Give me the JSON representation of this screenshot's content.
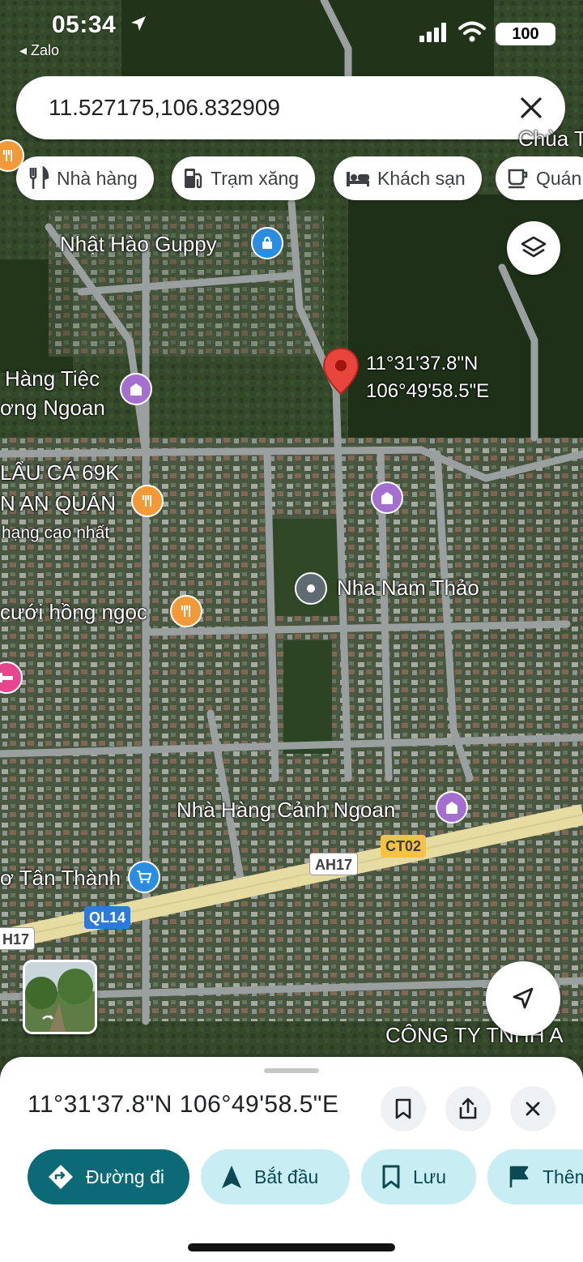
{
  "status_bar": {
    "time": "05:34",
    "back_app": "◂ Zalo",
    "battery": "100"
  },
  "search": {
    "value": "11.527175,106.832909"
  },
  "chips": [
    {
      "label": "Nhà hàng",
      "icon": "fork-knife-icon"
    },
    {
      "label": "Trạm xăng",
      "icon": "gas-station-icon"
    },
    {
      "label": "Khách sạn",
      "icon": "bed-icon"
    },
    {
      "label": "Quán",
      "icon": "coffee-cup-icon"
    }
  ],
  "map": {
    "pin_coords": {
      "line1": "11°31'37.8\"N",
      "line2": "106°49'58.5\"E"
    },
    "labels": {
      "guppy": "Nhật Hào Guppy",
      "hang_tiec_1": "Hàng Tiệc",
      "hang_tiec_2": "ơng Ngoan",
      "lau_ca_1": "LẨU CÁ 69K",
      "lau_ca_2": "N AN QUÁN",
      "lau_ca_3": "hạng cao nhất",
      "nam_thao": "Nha Nam Thảo",
      "hong_ngoc": "cưới hồng ngọc",
      "canh_ngoan": "Nhà Hàng Cảnh Ngoan",
      "tan_thanh": "ơ Tân Thành",
      "chua": "Chùa T",
      "cong_ty": "CÔNG TY TNHH A"
    },
    "road_badges": {
      "ah17": "AH17",
      "ct02": "CT02",
      "ql14": "QL14",
      "h17": "H17"
    }
  },
  "sheet": {
    "title": "11°31'37.8\"N 106°49'58.5\"E",
    "actions": [
      {
        "label": "Đường đi",
        "icon": "directions-icon"
      },
      {
        "label": "Bắt đầu",
        "icon": "navigation-arrow-icon"
      },
      {
        "label": "Lưu",
        "icon": "bookmark-icon"
      },
      {
        "label": "Thêm",
        "icon": "flag-icon"
      }
    ]
  },
  "colors": {
    "accent": "#0b6a75",
    "accent_light": "#c8eef4",
    "pin": "#e8453c"
  }
}
